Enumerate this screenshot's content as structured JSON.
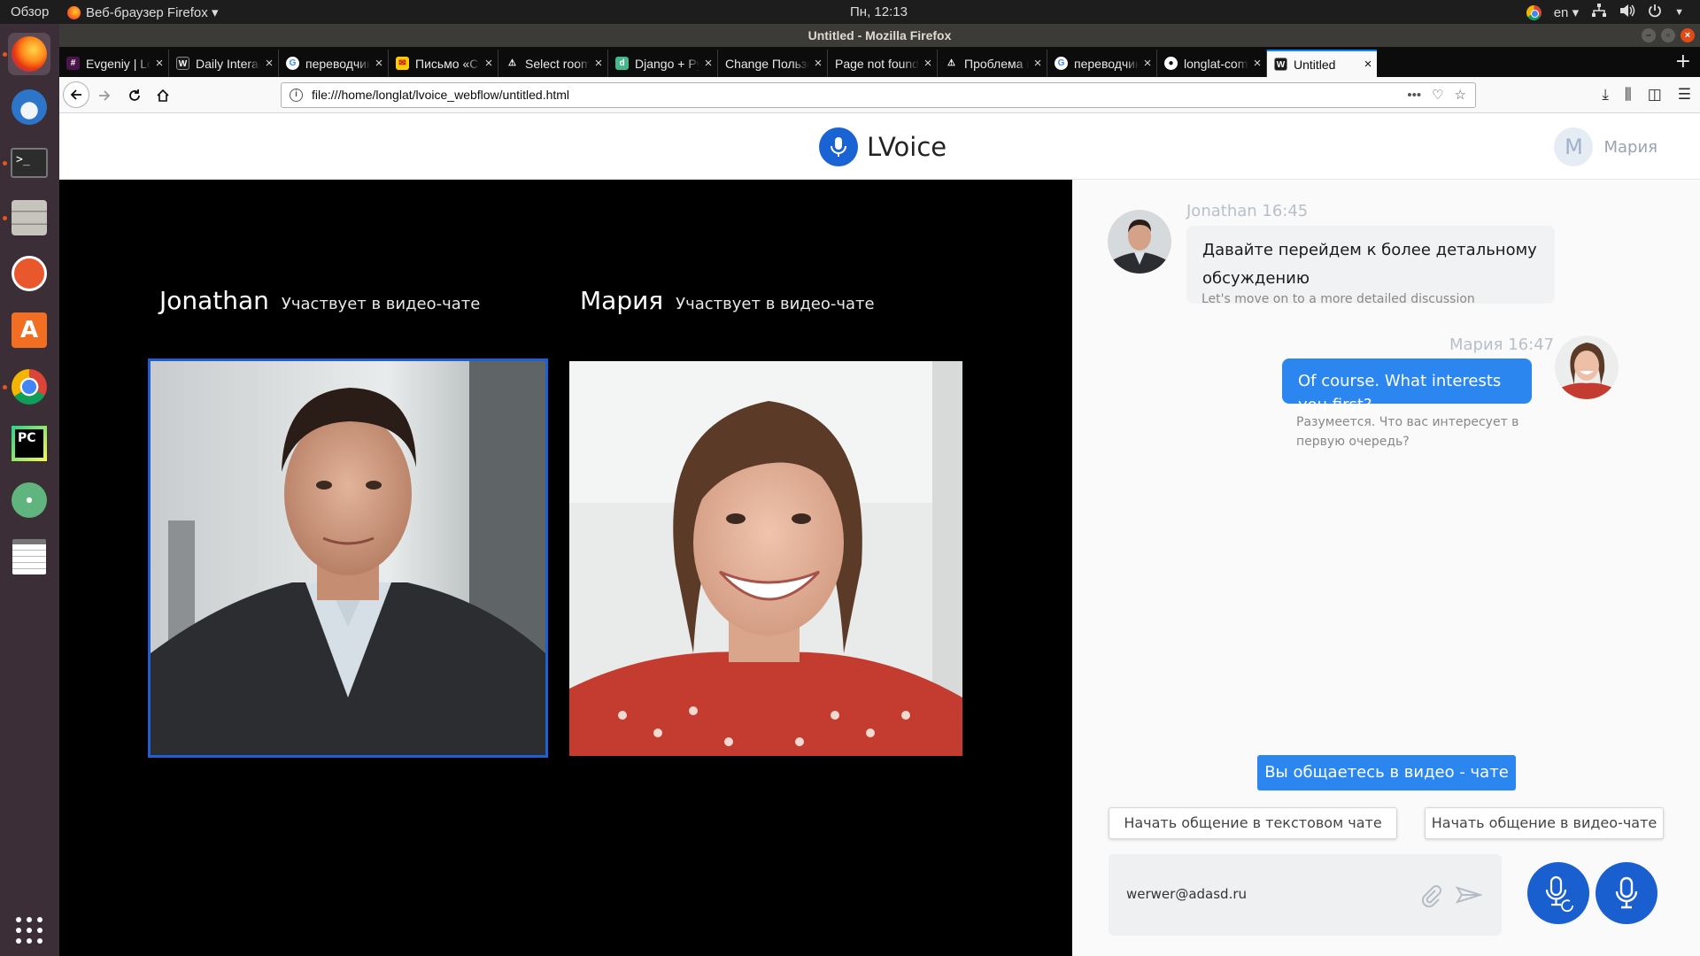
{
  "system": {
    "overview": "Обзор",
    "app_menu": "Веб-браузер Firefox ▾",
    "clock": "Пн, 12:13",
    "lang": "en ▾"
  },
  "window": {
    "title": "Untitled - Mozilla Firefox"
  },
  "tabs": [
    {
      "label": "Evgeniy | Lond",
      "icon": "slack-icon"
    },
    {
      "label": "Daily Interacti",
      "icon": "webflow-icon"
    },
    {
      "label": "переводчик",
      "icon": "google-icon"
    },
    {
      "label": "Письмо «Сер",
      "icon": "mail-icon"
    },
    {
      "label": "Select rooms",
      "icon": "warning-icon"
    },
    {
      "label": "Django + Pyth",
      "icon": "django-icon"
    },
    {
      "label": "Change Пользов",
      "icon": ""
    },
    {
      "label": "Page not found а",
      "icon": ""
    },
    {
      "label": "Проблема пр",
      "icon": "warning-icon"
    },
    {
      "label": "переводчик",
      "icon": "google-icon"
    },
    {
      "label": "longlat-comp",
      "icon": "github-icon"
    },
    {
      "label": "Untitled",
      "icon": "webflow-icon"
    }
  ],
  "url": "file:///home/longlat/lvoice_webflow/untitled.html",
  "app": {
    "brand": "LVoice",
    "user_initial": "M",
    "user_name": "Мария"
  },
  "participants": [
    {
      "name": "Jonathan",
      "status": "Участвует в видео-чате"
    },
    {
      "name": "Мария",
      "status": "Участвует в видео-чате"
    }
  ],
  "messages": [
    {
      "author": "Jonathan",
      "time": "16:45",
      "meta": "Jonathan 16:45",
      "text": "Давайте перейдем к более детальному обсуждению",
      "translation": "Let's move on to a more detailed discussion"
    },
    {
      "author": "Мария",
      "time": "16:47",
      "meta": "Мария 16:47",
      "text": "Of course. What interests you first?",
      "translation": "Разумеется. Что вас интересует в первую очередь?"
    }
  ],
  "chat": {
    "status_pill": "Вы общаетесь в видео - чате",
    "btn_text_chat": "Начать общение в текстовом чате",
    "btn_video_chat": "Начать общение в видео-чате",
    "input_value": "werwer@adasd.ru"
  },
  "colors": {
    "accent": "#2b87ef",
    "brand": "#1a63d4",
    "active_frame": "#1f5fd6"
  }
}
